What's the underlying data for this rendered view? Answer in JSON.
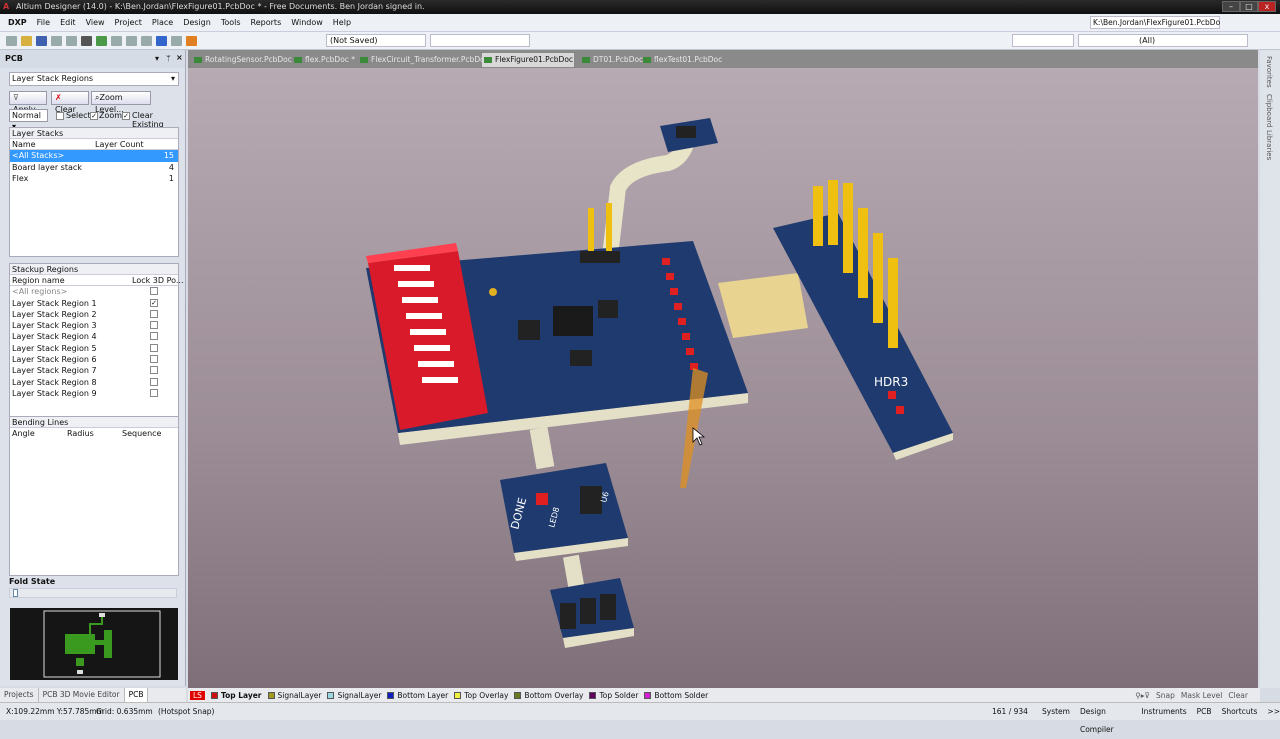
{
  "window": {
    "title": "Altium Designer (14.0) - K:\\Ben.Jordan\\FlexFigure01.PcbDoc * - Free Documents. Ben Jordan signed in.",
    "min": "–",
    "max": "□",
    "close": "x"
  },
  "menu": [
    "DXP",
    "File",
    "Edit",
    "View",
    "Project",
    "Place",
    "Design",
    "Tools",
    "Reports",
    "Window",
    "Help"
  ],
  "toolbar": {
    "saved_state": "(Not Saved)",
    "doc_path": "K:\\Ben.Jordan\\FlexFigure01.PcbDo",
    "filter": "(All)"
  },
  "doc_tabs": [
    {
      "label": "RotatingSensor.PcbDoc"
    },
    {
      "label": "flex.PcbDoc *"
    },
    {
      "label": "FlexCircuit_Transformer.PcbDoc"
    },
    {
      "label": "FlexFigure01.PcbDoc *",
      "active": true
    },
    {
      "label": "DT01.PcbDoc"
    },
    {
      "label": "flexTest01.PcbDoc"
    }
  ],
  "panel": {
    "title": "PCB",
    "mode": "Layer Stack Regions",
    "buttons": {
      "apply": "Apply",
      "clear": "Clear",
      "zoom_level": "Zoom Level..."
    },
    "mask_mode": "Normal",
    "select": "Select",
    "zoom": "Zoom",
    "clear_existing": "Clear Existing",
    "select_checked": false,
    "zoom_checked": true,
    "clear_existing_checked": true,
    "layer_stacks": {
      "title": "Layer Stacks",
      "headers": [
        "Name",
        "Layer Count"
      ],
      "rows": [
        {
          "name": "<All Stacks>",
          "count": "15",
          "selected": true
        },
        {
          "name": "Board layer stack",
          "count": "4"
        },
        {
          "name": "Flex",
          "count": "1"
        }
      ]
    },
    "stackup_regions": {
      "title": "Stackup Regions",
      "headers": [
        "Region name",
        "Lock 3D Po..."
      ],
      "rows": [
        {
          "name": "<All regions>",
          "locked": false
        },
        {
          "name": "Layer Stack Region 1",
          "locked": true
        },
        {
          "name": "Layer Stack Region 2",
          "locked": false
        },
        {
          "name": "Layer Stack Region 3",
          "locked": false
        },
        {
          "name": "Layer Stack Region 4",
          "locked": false
        },
        {
          "name": "Layer Stack Region 5",
          "locked": false
        },
        {
          "name": "Layer Stack Region 6",
          "locked": false
        },
        {
          "name": "Layer Stack Region 7",
          "locked": false
        },
        {
          "name": "Layer Stack Region 8",
          "locked": false
        },
        {
          "name": "Layer Stack Region 9",
          "locked": false
        }
      ]
    },
    "bending_lines": {
      "title": "Bending Lines",
      "headers": [
        "Angle",
        "Radius",
        "Sequence"
      ]
    },
    "fold_state": {
      "title": "Fold State",
      "value": 0
    }
  },
  "right_tabs": [
    "Favorites",
    "Clipboard",
    "Libraries"
  ],
  "board_labels": {
    "header": "HDR3",
    "done": "DONE",
    "led": "LED8",
    "u6": "U6"
  },
  "panel_tabs": [
    "Projects",
    "PCB 3D Movie Editor",
    "PCB"
  ],
  "layers": [
    {
      "name": "LS",
      "color": "#e00000"
    },
    {
      "name": "Top Layer",
      "color": "#d01010",
      "active": true
    },
    {
      "name": "SignalLayer",
      "color": "#a09a20"
    },
    {
      "name": "SignalLayer",
      "color": "#9ad8e0"
    },
    {
      "name": "Bottom Layer",
      "color": "#1020c0"
    },
    {
      "name": "Top Overlay",
      "color": "#f0f040"
    },
    {
      "name": "Bottom Overlay",
      "color": "#6a7a20"
    },
    {
      "name": "Top Solder",
      "color": "#600060"
    },
    {
      "name": "Bottom Solder",
      "color": "#d020d0"
    }
  ],
  "mask_controls": [
    "Snap",
    "Mask Level",
    "Clear"
  ],
  "status": {
    "coords": "X:109.22mm Y:57.785mm",
    "grid": "Grid: 0.635mm",
    "snap": "(Hotspot Snap)",
    "count": "161 / 934",
    "buttons": [
      "System",
      "Design Compiler",
      "Instruments",
      "PCB",
      "Shortcuts",
      ">>"
    ]
  }
}
